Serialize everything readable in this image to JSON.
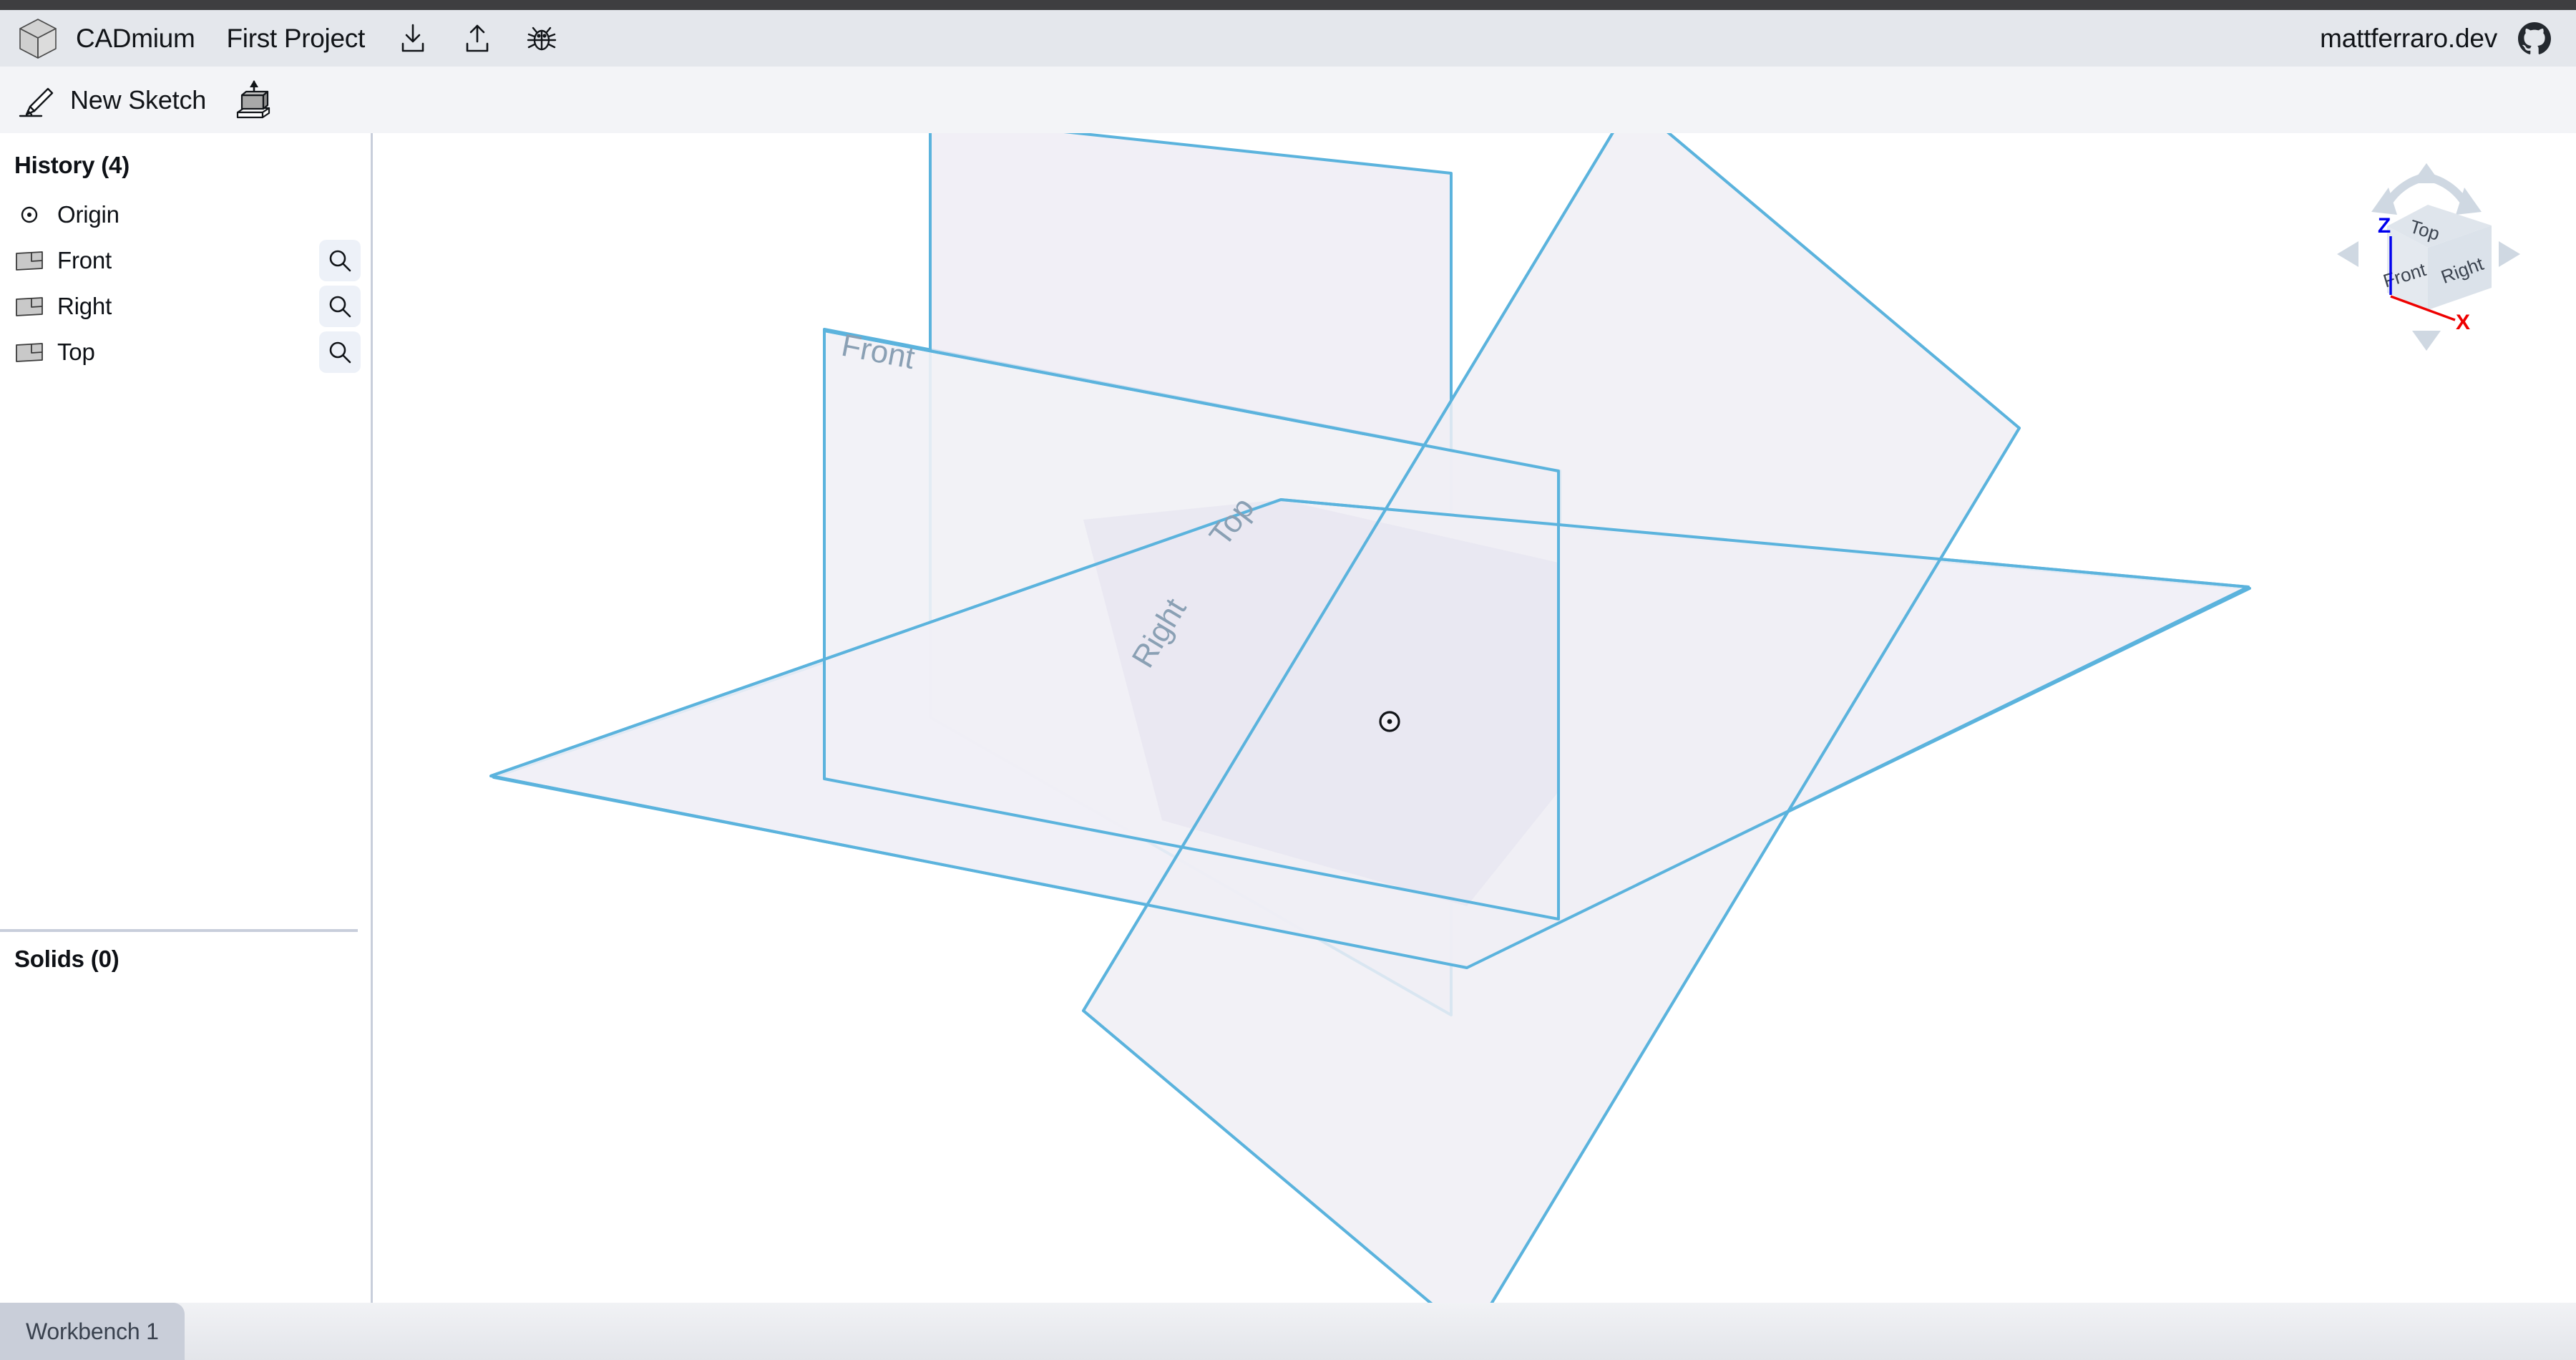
{
  "header": {
    "logo_icon": "cube-logo-icon",
    "app_title": "CADmium",
    "project_name": "First Project",
    "download_icon": "download-icon",
    "upload_icon": "upload-icon",
    "bug_icon": "bug-icon",
    "author_link": "mattferraro.dev",
    "github_icon": "github-icon"
  },
  "toolbar": {
    "new_sketch_label": "New Sketch",
    "new_sketch_icon": "pencil-icon",
    "extrude_icon": "extrude-icon"
  },
  "sidebar": {
    "history_heading": "History (4)",
    "solids_heading": "Solids (0)",
    "history_items": [
      {
        "label": "Origin",
        "icon": "origin-point-icon",
        "has_zoom": false
      },
      {
        "label": "Front",
        "icon": "plane-icon",
        "has_zoom": true
      },
      {
        "label": "Right",
        "icon": "plane-icon",
        "has_zoom": true
      },
      {
        "label": "Top",
        "icon": "plane-icon",
        "has_zoom": true
      }
    ],
    "zoom_icon": "search-icon"
  },
  "viewport": {
    "planes": [
      {
        "name": "Front",
        "label": "Front"
      },
      {
        "name": "Top",
        "label": "Top"
      },
      {
        "name": "Right",
        "label": "Right"
      }
    ],
    "origin_marker": "origin-point-icon"
  },
  "viewcube": {
    "top_label": "Top",
    "front_label": "Front",
    "right_label": "Right",
    "z_axis_label": "Z",
    "x_axis_label": "X",
    "z_axis_color": "#0000ee",
    "x_axis_color": "#ee0000"
  },
  "bottombar": {
    "workbench_tab": "Workbench 1"
  },
  "colors": {
    "plane_stroke": "#5bb3dd",
    "plane_fill": "#f4f3f8",
    "top_strip": "#3e3e40",
    "header_bg": "#e4e7ec",
    "toolbar_bg": "#f3f4f7",
    "border": "#c8cedb",
    "label_gray": "#8aa0b4"
  }
}
